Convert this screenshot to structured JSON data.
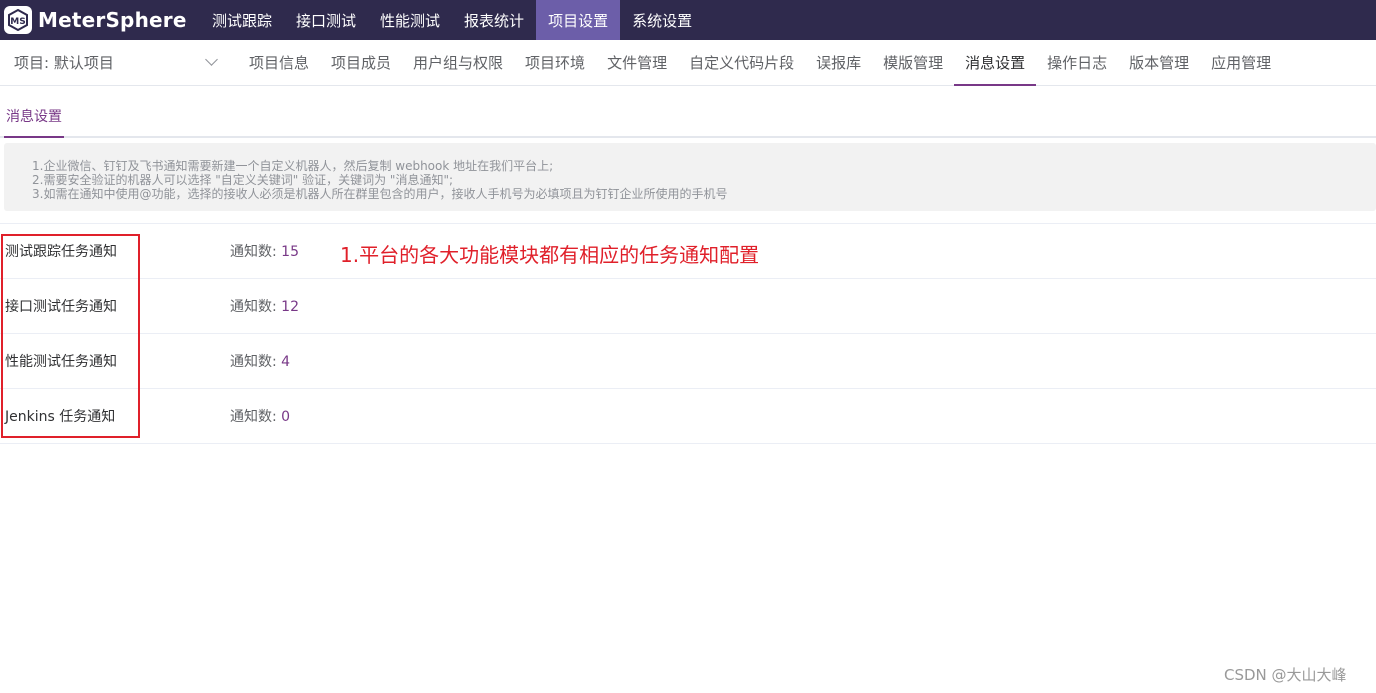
{
  "app": {
    "name": "MeterSphere"
  },
  "top_nav": {
    "items": [
      {
        "label": "测试跟踪",
        "active": false
      },
      {
        "label": "接口测试",
        "active": false
      },
      {
        "label": "性能测试",
        "active": false
      },
      {
        "label": "报表统计",
        "active": false
      },
      {
        "label": "项目设置",
        "active": true
      },
      {
        "label": "系统设置",
        "active": false
      }
    ]
  },
  "project_selector": {
    "label": "项目: 默认项目"
  },
  "sub_nav": {
    "items": [
      {
        "label": "项目信息",
        "active": false
      },
      {
        "label": "项目成员",
        "active": false
      },
      {
        "label": "用户组与权限",
        "active": false
      },
      {
        "label": "项目环境",
        "active": false
      },
      {
        "label": "文件管理",
        "active": false
      },
      {
        "label": "自定义代码片段",
        "active": false
      },
      {
        "label": "误报库",
        "active": false
      },
      {
        "label": "模版管理",
        "active": false
      },
      {
        "label": "消息设置",
        "active": true
      },
      {
        "label": "操作日志",
        "active": false
      },
      {
        "label": "版本管理",
        "active": false
      },
      {
        "label": "应用管理",
        "active": false
      }
    ]
  },
  "page_tab": {
    "label": "消息设置"
  },
  "tips": {
    "lines": [
      "1.企业微信、钉钉及飞书通知需要新建一个自定义机器人，然后复制 webhook 地址在我们平台上;",
      "2.需要安全验证的机器人可以选择 \"自定义关键词\" 验证，关键词为 \"消息通知\";",
      "3.如需在通知中使用@功能，选择的接收人必须是机器人所在群里包含的用户，接收人手机号为必填项且为钉钉企业所使用的手机号"
    ]
  },
  "notifications": {
    "count_label": "通知数: ",
    "rows": [
      {
        "name": "测试跟踪任务通知",
        "count": "15"
      },
      {
        "name": "接口测试任务通知",
        "count": "12"
      },
      {
        "name": "性能测试任务通知",
        "count": "4"
      },
      {
        "name": "Jenkins 任务通知",
        "count": "0"
      }
    ]
  },
  "annotation": {
    "text": "1.平台的各大功能模块都有相应的任务通知配置"
  },
  "watermark": {
    "text": "CSDN @大山大峰"
  },
  "colors": {
    "topbar": "#2f2a4d",
    "topnav_active": "#6c5ea9",
    "accent": "#783887",
    "annotation": "#e0202a"
  }
}
